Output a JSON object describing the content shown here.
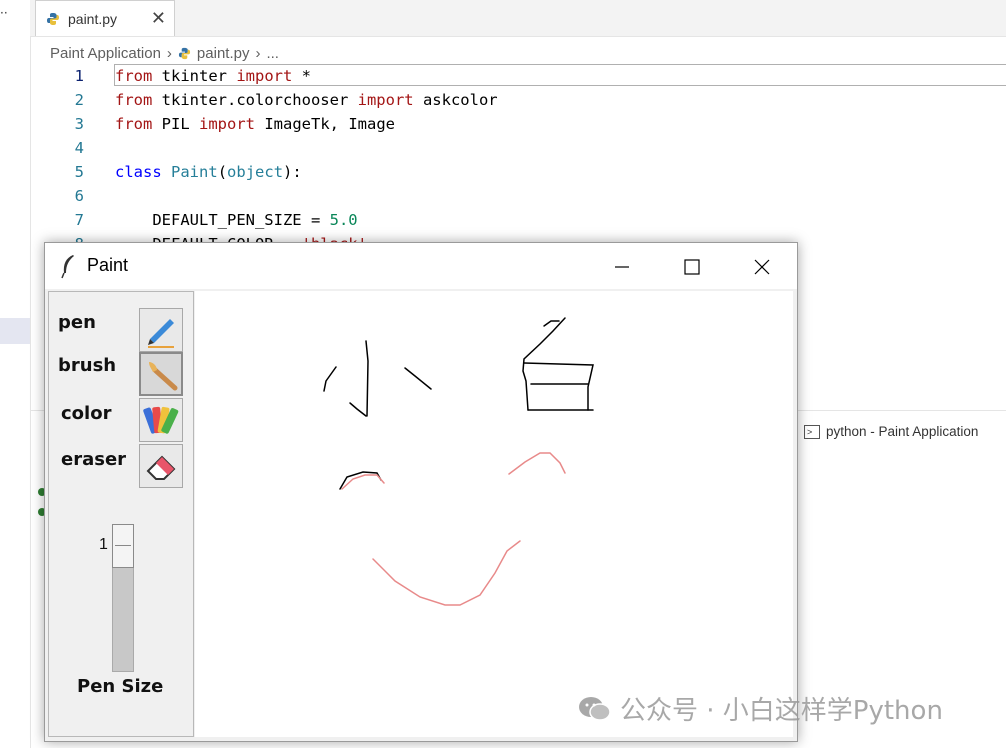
{
  "editor": {
    "tab": {
      "filename": "paint.py",
      "close_glyph": "✕"
    },
    "breadcrumb": {
      "root": "Paint Application",
      "sep": "›",
      "file": "paint.py",
      "more": "..."
    },
    "left_dots": "··",
    "lines": [
      {
        "n": "1"
      },
      {
        "n": "2"
      },
      {
        "n": "3"
      },
      {
        "n": "4"
      },
      {
        "n": "5"
      },
      {
        "n": "6"
      },
      {
        "n": "7"
      },
      {
        "n": "8"
      }
    ],
    "code": {
      "l1": {
        "k1": "from",
        "t1": " tkinter ",
        "k2": "import",
        "t2": " *"
      },
      "l2": {
        "k1": "from",
        "t1": " tkinter.colorchooser ",
        "k2": "import",
        "t2": " askcolor"
      },
      "l3": {
        "k1": "from",
        "t1": " PIL ",
        "k2": "import",
        "t2": " ImageTk, Image"
      },
      "l5": {
        "k1": "class",
        "t1": " ",
        "cls": "Paint",
        "t2": "(",
        "cls2": "object",
        "t3": "):"
      },
      "l7": {
        "t1": "    DEFAULT_PEN_SIZE = ",
        "num": "5.0"
      },
      "l8": {
        "t1": "    DEFAULT_COLOR = ",
        "str": "'black'"
      }
    },
    "terminal_label": "python - Paint Application"
  },
  "paint_window": {
    "title": "Paint",
    "tools": [
      {
        "label": "pen",
        "icon": "pen-icon"
      },
      {
        "label": "brush",
        "icon": "brush-icon"
      },
      {
        "label": "color",
        "icon": "color-palette-icon"
      },
      {
        "label": "eraser",
        "icon": "eraser-icon"
      }
    ],
    "active_tool": "brush",
    "pen_size_value": "1",
    "pen_size_label": "Pen Size",
    "colors": {
      "black_stroke": "#000000",
      "pink_stroke": "#e88a8a"
    }
  },
  "watermark": {
    "text": "公众号 · 小白这样学Python"
  }
}
